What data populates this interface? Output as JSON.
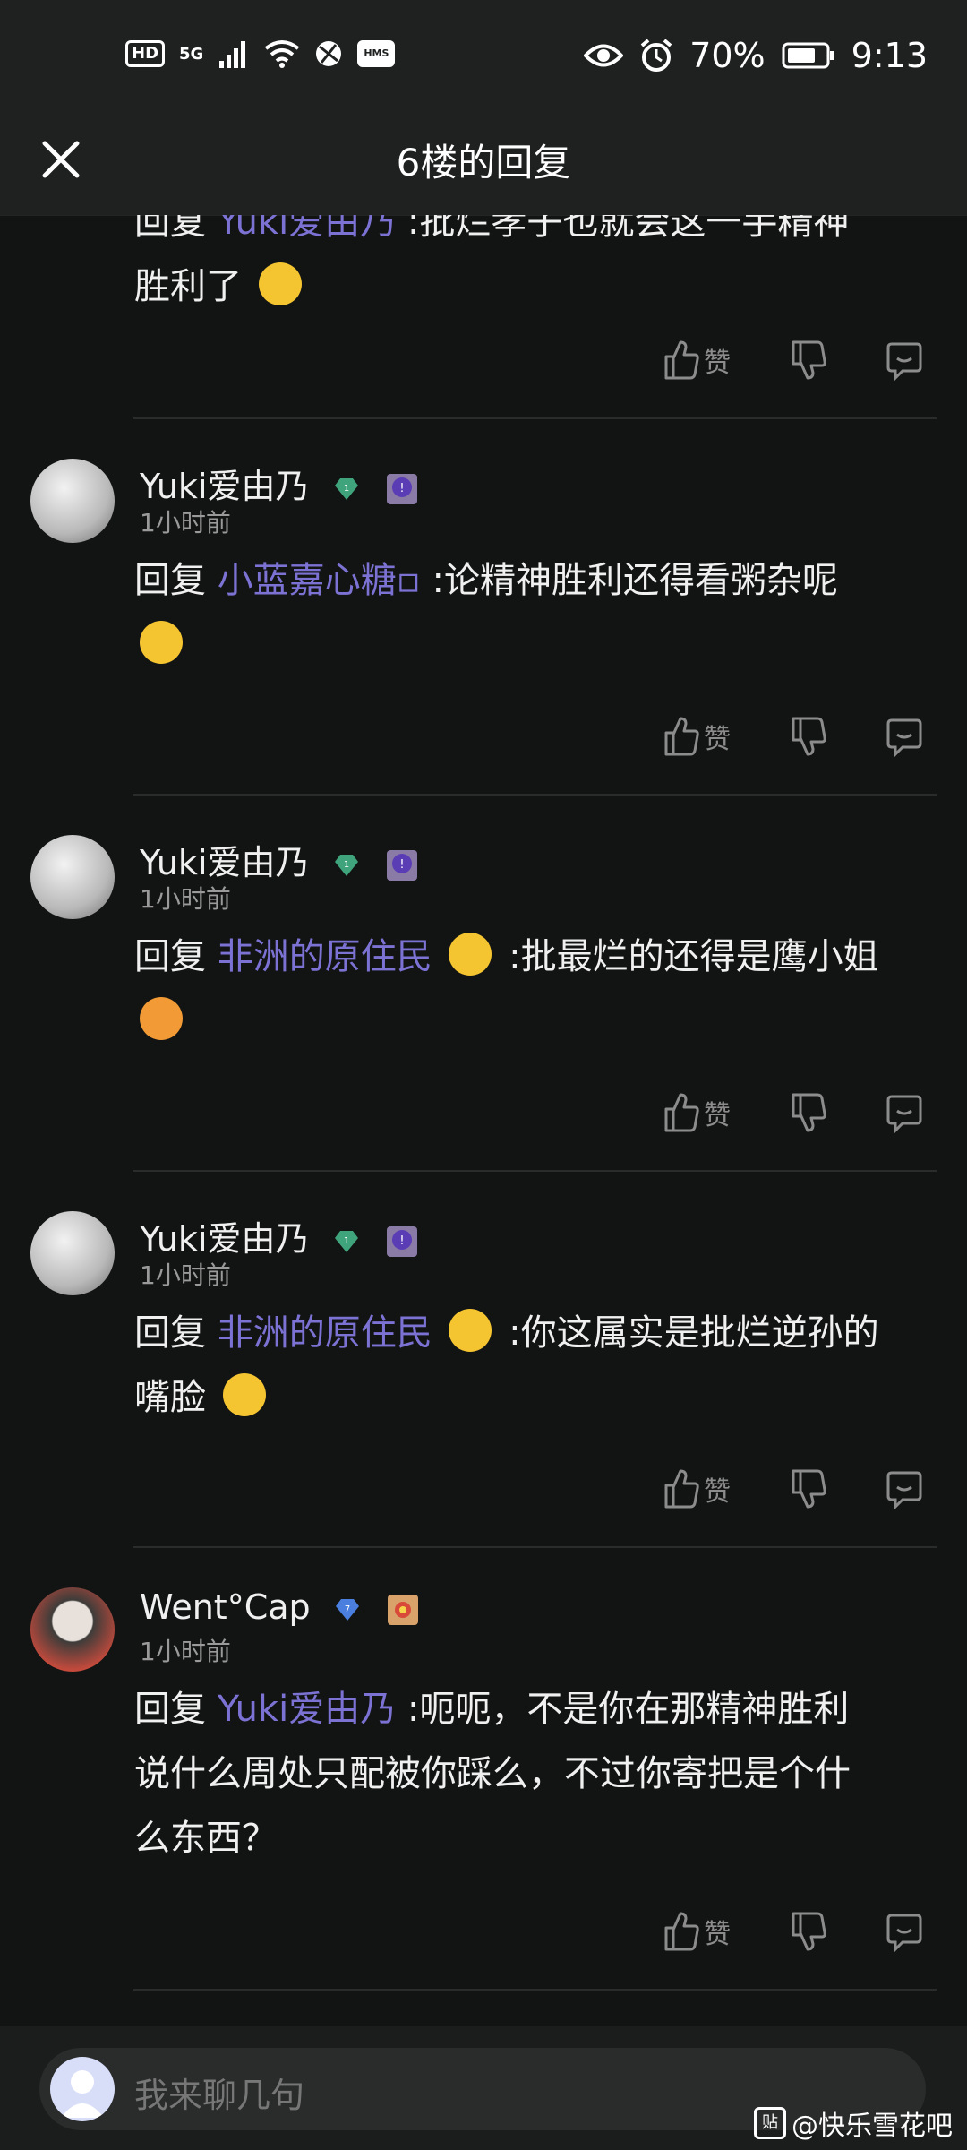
{
  "status_bar": {
    "hd": "HD",
    "signal": "5G",
    "hms": "HMS",
    "battery": "70%",
    "time": "9:13"
  },
  "header": {
    "title": "6楼的回复"
  },
  "comments": [
    {
      "reply_prefix": "回复",
      "reply_to": "Yuki爱由乃",
      "text_line1": ":批烂孝子也就会这一手精神",
      "text_line2": "胜利了",
      "like_label": "赞"
    },
    {
      "user": "Yuki爱由乃",
      "gem_level": "1",
      "time": "1小时前",
      "reply_prefix": "回复",
      "reply_to": "小蓝嘉心糖▫",
      "text": ":论精神胜利还得看粥杂呢",
      "like_label": "赞"
    },
    {
      "user": "Yuki爱由乃",
      "gem_level": "1",
      "time": "1小时前",
      "reply_prefix": "回复",
      "reply_to": "非洲的原住民",
      "text": ":批最烂的还得是鹰小姐",
      "like_label": "赞"
    },
    {
      "user": "Yuki爱由乃",
      "gem_level": "1",
      "time": "1小时前",
      "reply_prefix": "回复",
      "reply_to": "非洲的原住民",
      "text_line1": ":你这属实是批烂逆孙的",
      "text_line2": "嘴脸",
      "like_label": "赞"
    },
    {
      "user": "Went°Cap",
      "gem_level": "7",
      "time": "1小时前",
      "reply_prefix": "回复",
      "reply_to": "Yuki爱由乃",
      "text_line1": ":呃呃，不是你在那精神胜利",
      "text_line2": "说什么周处只配被你踩么，不过你寄把是个什",
      "text_line3": "么东西？",
      "like_label": "赞"
    }
  ],
  "composer": {
    "placeholder": "我来聊几句"
  },
  "watermark": {
    "box": "贴",
    "text": "@快乐雪花吧"
  },
  "colors": {
    "accent_link": "#7c72d4",
    "background": "#121413",
    "gem_green": "#3fa37b",
    "gem_blue": "#4a7fe0"
  },
  "icons": [
    "close-icon",
    "thumb-up-icon",
    "thumb-down-icon",
    "comment-icon",
    "eye-icon",
    "alarm-icon",
    "wifi-icon",
    "battery-icon"
  ]
}
